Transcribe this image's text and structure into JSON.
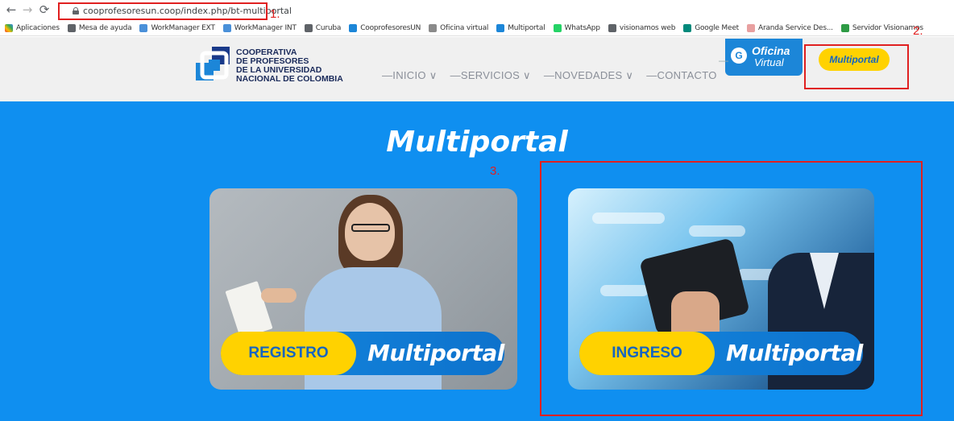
{
  "browser": {
    "url": "coopr​ofesoresun.coop/index.php/bt-multiportal",
    "bookmarks": [
      {
        "label": "Aplicaciones",
        "color": "#e94235"
      },
      {
        "label": "Mesa de ayuda",
        "color": "#5f6368"
      },
      {
        "label": "WorkManager EXT",
        "color": "#4a90d9"
      },
      {
        "label": "WorkManager INT",
        "color": "#4a90d9"
      },
      {
        "label": "Curuba",
        "color": "#5f6368"
      },
      {
        "label": "CooprofesoresUN",
        "color": "#1c86d8"
      },
      {
        "label": "Oficina virtual",
        "color": "#8a8a8a"
      },
      {
        "label": "Multiportal",
        "color": "#1c86d8"
      },
      {
        "label": "WhatsApp",
        "color": "#25d366"
      },
      {
        "label": "visionamos web",
        "color": "#5f6368"
      },
      {
        "label": "Google Meet",
        "color": "#00897b"
      },
      {
        "label": "Aranda Service Des...",
        "color": "#e8a0a0"
      },
      {
        "label": "Servidor Visionamos",
        "color": "#2e9b45"
      }
    ]
  },
  "annotations": [
    "1.",
    "2.",
    "3."
  ],
  "header": {
    "logo_lines": [
      "COOPERATIVA",
      "DE PROFESORES",
      "DE LA UNIVERSIDAD",
      "NACIONAL DE COLOMBIA"
    ],
    "menu": [
      "—INICIO ∨",
      "—SERVICIOS ∨",
      "—NOVEDADES ∨",
      "—CONTACTO"
    ],
    "oficina_line1": "Oficina",
    "oficina_line2": "Virtual",
    "multiportal_button": "Multiportal"
  },
  "main": {
    "title": "Multiportal",
    "cards": [
      {
        "action": "REGISTRO",
        "label": "Multiportal"
      },
      {
        "action": "INGRESO",
        "label": "Multiportal"
      }
    ]
  },
  "colors": {
    "accent_blue": "#0f8ff0",
    "yellow": "#ffd200",
    "annotation_red": "#e02020"
  }
}
